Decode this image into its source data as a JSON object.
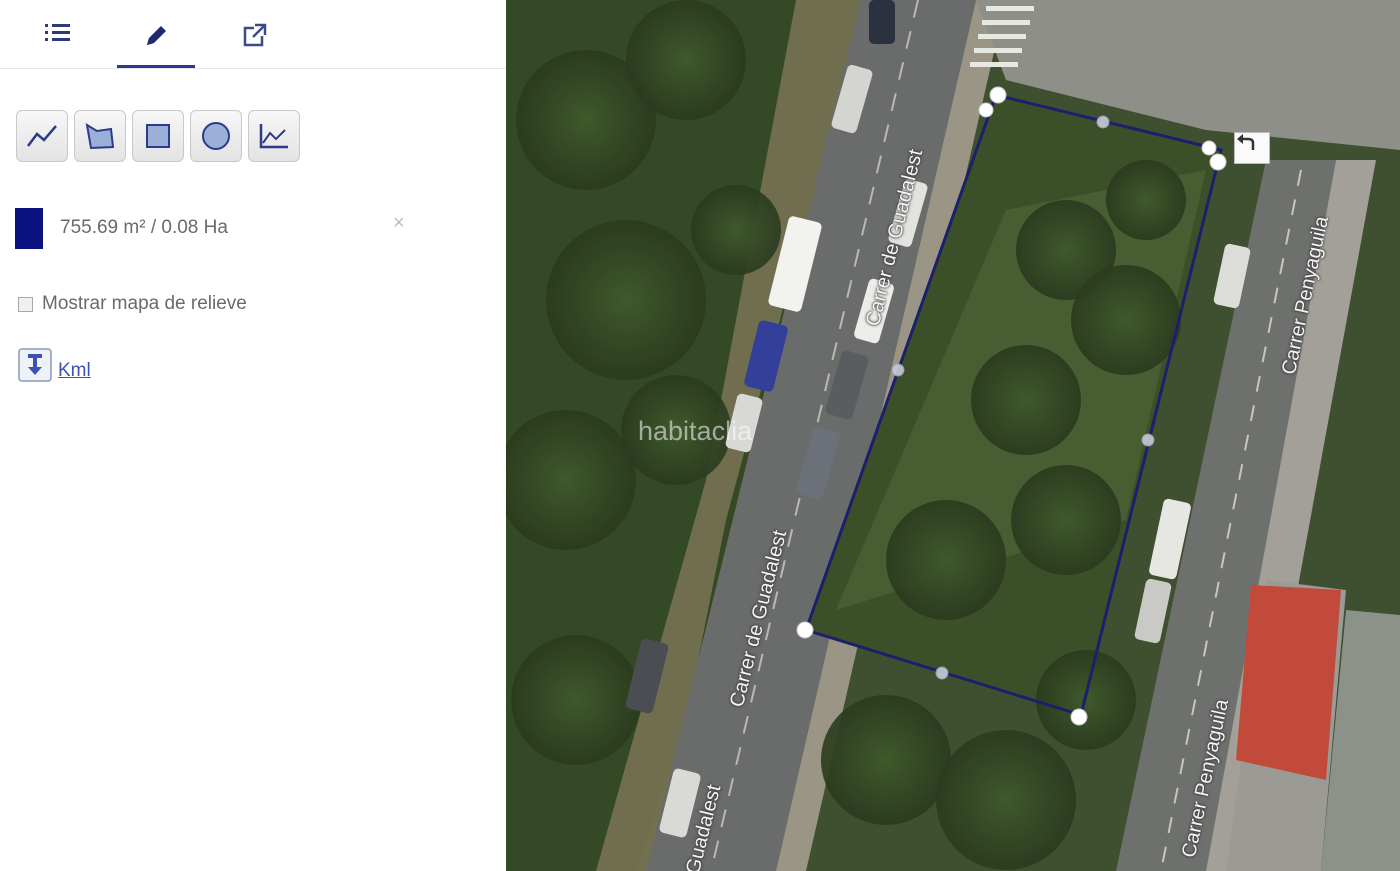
{
  "tabs": [
    {
      "icon": "list-icon"
    },
    {
      "icon": "pencil-icon",
      "active": true
    },
    {
      "icon": "external-link-icon"
    }
  ],
  "tools": [
    {
      "icon": "line-measure-icon"
    },
    {
      "icon": "polygon-measure-icon"
    },
    {
      "icon": "rectangle-icon"
    },
    {
      "icon": "circle-icon"
    },
    {
      "icon": "elevation-profile-icon"
    }
  ],
  "measurement": {
    "area_text": "755.69 m² / 0.08 Ha",
    "swatch_color": "#0a1280",
    "remove_label": "×"
  },
  "relief": {
    "label": "Mostrar mapa de relieve",
    "checked": false
  },
  "kml": {
    "label": "Kml",
    "icon": "download-icon"
  },
  "map": {
    "streets": [
      {
        "name": "Carrer de Guadalest"
      },
      {
        "name": "Carrer de Guadalest"
      },
      {
        "name": "Carrer Penyaguila"
      },
      {
        "name": "Carrer Penyaguila"
      },
      {
        "name": "Guadalest"
      }
    ],
    "watermark": "habitaclia",
    "polygon_color": "#1c1f6e",
    "undo_icon": "undo-icon"
  }
}
